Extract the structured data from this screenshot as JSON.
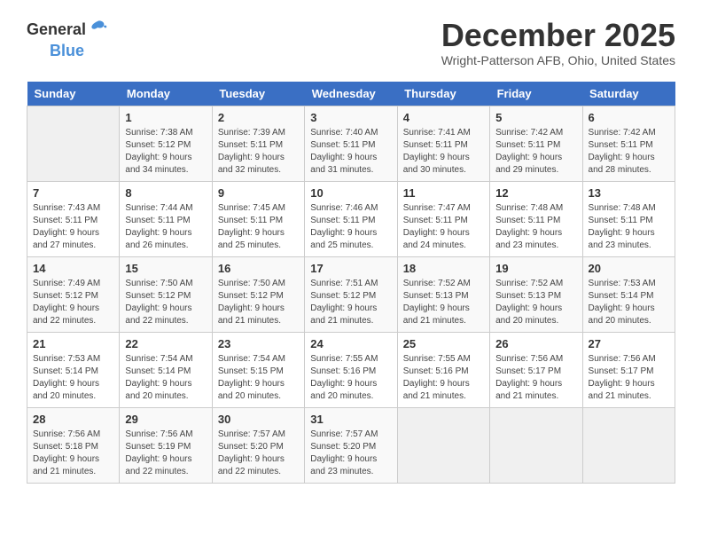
{
  "logo": {
    "text1": "General",
    "text2": "Blue"
  },
  "title": "December 2025",
  "subtitle": "Wright-Patterson AFB, Ohio, United States",
  "weekdays": [
    "Sunday",
    "Monday",
    "Tuesday",
    "Wednesday",
    "Thursday",
    "Friday",
    "Saturday"
  ],
  "weeks": [
    [
      {
        "day": "",
        "info": ""
      },
      {
        "day": "1",
        "info": "Sunrise: 7:38 AM\nSunset: 5:12 PM\nDaylight: 9 hours\nand 34 minutes."
      },
      {
        "day": "2",
        "info": "Sunrise: 7:39 AM\nSunset: 5:11 PM\nDaylight: 9 hours\nand 32 minutes."
      },
      {
        "day": "3",
        "info": "Sunrise: 7:40 AM\nSunset: 5:11 PM\nDaylight: 9 hours\nand 31 minutes."
      },
      {
        "day": "4",
        "info": "Sunrise: 7:41 AM\nSunset: 5:11 PM\nDaylight: 9 hours\nand 30 minutes."
      },
      {
        "day": "5",
        "info": "Sunrise: 7:42 AM\nSunset: 5:11 PM\nDaylight: 9 hours\nand 29 minutes."
      },
      {
        "day": "6",
        "info": "Sunrise: 7:42 AM\nSunset: 5:11 PM\nDaylight: 9 hours\nand 28 minutes."
      }
    ],
    [
      {
        "day": "7",
        "info": "Sunrise: 7:43 AM\nSunset: 5:11 PM\nDaylight: 9 hours\nand 27 minutes."
      },
      {
        "day": "8",
        "info": "Sunrise: 7:44 AM\nSunset: 5:11 PM\nDaylight: 9 hours\nand 26 minutes."
      },
      {
        "day": "9",
        "info": "Sunrise: 7:45 AM\nSunset: 5:11 PM\nDaylight: 9 hours\nand 25 minutes."
      },
      {
        "day": "10",
        "info": "Sunrise: 7:46 AM\nSunset: 5:11 PM\nDaylight: 9 hours\nand 25 minutes."
      },
      {
        "day": "11",
        "info": "Sunrise: 7:47 AM\nSunset: 5:11 PM\nDaylight: 9 hours\nand 24 minutes."
      },
      {
        "day": "12",
        "info": "Sunrise: 7:48 AM\nSunset: 5:11 PM\nDaylight: 9 hours\nand 23 minutes."
      },
      {
        "day": "13",
        "info": "Sunrise: 7:48 AM\nSunset: 5:11 PM\nDaylight: 9 hours\nand 23 minutes."
      }
    ],
    [
      {
        "day": "14",
        "info": "Sunrise: 7:49 AM\nSunset: 5:12 PM\nDaylight: 9 hours\nand 22 minutes."
      },
      {
        "day": "15",
        "info": "Sunrise: 7:50 AM\nSunset: 5:12 PM\nDaylight: 9 hours\nand 22 minutes."
      },
      {
        "day": "16",
        "info": "Sunrise: 7:50 AM\nSunset: 5:12 PM\nDaylight: 9 hours\nand 21 minutes."
      },
      {
        "day": "17",
        "info": "Sunrise: 7:51 AM\nSunset: 5:12 PM\nDaylight: 9 hours\nand 21 minutes."
      },
      {
        "day": "18",
        "info": "Sunrise: 7:52 AM\nSunset: 5:13 PM\nDaylight: 9 hours\nand 21 minutes."
      },
      {
        "day": "19",
        "info": "Sunrise: 7:52 AM\nSunset: 5:13 PM\nDaylight: 9 hours\nand 20 minutes."
      },
      {
        "day": "20",
        "info": "Sunrise: 7:53 AM\nSunset: 5:14 PM\nDaylight: 9 hours\nand 20 minutes."
      }
    ],
    [
      {
        "day": "21",
        "info": "Sunrise: 7:53 AM\nSunset: 5:14 PM\nDaylight: 9 hours\nand 20 minutes."
      },
      {
        "day": "22",
        "info": "Sunrise: 7:54 AM\nSunset: 5:14 PM\nDaylight: 9 hours\nand 20 minutes."
      },
      {
        "day": "23",
        "info": "Sunrise: 7:54 AM\nSunset: 5:15 PM\nDaylight: 9 hours\nand 20 minutes."
      },
      {
        "day": "24",
        "info": "Sunrise: 7:55 AM\nSunset: 5:16 PM\nDaylight: 9 hours\nand 20 minutes."
      },
      {
        "day": "25",
        "info": "Sunrise: 7:55 AM\nSunset: 5:16 PM\nDaylight: 9 hours\nand 21 minutes."
      },
      {
        "day": "26",
        "info": "Sunrise: 7:56 AM\nSunset: 5:17 PM\nDaylight: 9 hours\nand 21 minutes."
      },
      {
        "day": "27",
        "info": "Sunrise: 7:56 AM\nSunset: 5:17 PM\nDaylight: 9 hours\nand 21 minutes."
      }
    ],
    [
      {
        "day": "28",
        "info": "Sunrise: 7:56 AM\nSunset: 5:18 PM\nDaylight: 9 hours\nand 21 minutes."
      },
      {
        "day": "29",
        "info": "Sunrise: 7:56 AM\nSunset: 5:19 PM\nDaylight: 9 hours\nand 22 minutes."
      },
      {
        "day": "30",
        "info": "Sunrise: 7:57 AM\nSunset: 5:20 PM\nDaylight: 9 hours\nand 22 minutes."
      },
      {
        "day": "31",
        "info": "Sunrise: 7:57 AM\nSunset: 5:20 PM\nDaylight: 9 hours\nand 23 minutes."
      },
      {
        "day": "",
        "info": ""
      },
      {
        "day": "",
        "info": ""
      },
      {
        "day": "",
        "info": ""
      }
    ]
  ]
}
